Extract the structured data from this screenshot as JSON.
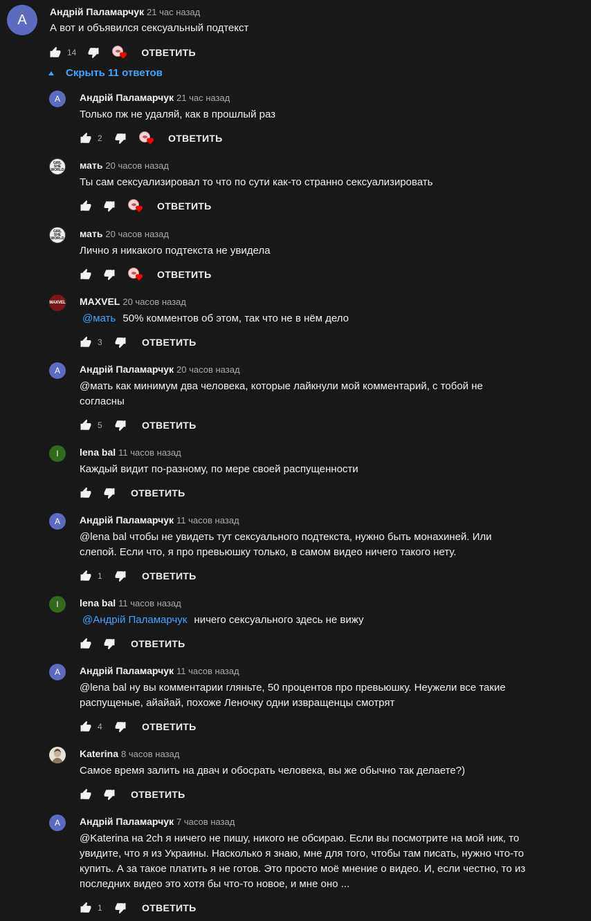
{
  "actions": {
    "reply_label": "ОТВЕТИТЬ"
  },
  "top_comment": {
    "avatar_letter": "A",
    "author": "Андрій Паламарчук",
    "time": "21 час назад",
    "text": "А вот и объявился сексуальный подтекст",
    "likes": "14",
    "hearted": true
  },
  "replies_toggle": {
    "label": "Скрыть 11 ответов"
  },
  "replies": [
    {
      "avatar": "A",
      "author": "Андрій Паламарчук",
      "time": "21 час назад",
      "mention": "",
      "text": "Только пж не удаляй, как в прошлый раз",
      "likes": "2",
      "hearted": true
    },
    {
      "avatar": "mat",
      "author": "мать",
      "time": "20 часов назад",
      "mention": "",
      "text": "Ты сам сексуализировал то что по сути как-то странно сексуализировать",
      "likes": "",
      "hearted": true
    },
    {
      "avatar": "mat",
      "author": "мать",
      "time": "20 часов назад",
      "mention": "",
      "text": "Лично я никакого подтекста не увидела",
      "likes": "",
      "hearted": true
    },
    {
      "avatar": "maxvel",
      "author": "MAXVEL",
      "time": "20 часов назад",
      "mention": "@мать",
      "text": "50% комментов об этом, так что не в нём дело",
      "likes": "3",
      "hearted": false
    },
    {
      "avatar": "A",
      "author": "Андрій Паламарчук",
      "time": "20 часов назад",
      "mention": "",
      "text": "@мать как минимум два человека, которые лайкнули мой комментарий, с тобой не согласны",
      "likes": "5",
      "hearted": false
    },
    {
      "avatar": "l",
      "author": "lena bal",
      "time": "11 часов назад",
      "mention": "",
      "text": "Каждый видит по-разному, по мере своей распущенности",
      "likes": "",
      "hearted": false
    },
    {
      "avatar": "A",
      "author": "Андрій Паламарчук",
      "time": "11 часов назад",
      "mention": "",
      "text": "@lena bal чтобы не увидеть тут сексуального подтекста, нужно быть монахиней. Или слепой. Если что, я про превьюшку только, в самом видео ничего такого нету.",
      "likes": "1",
      "hearted": false
    },
    {
      "avatar": "l",
      "author": "lena bal",
      "time": "11 часов назад",
      "mention": "@Андрій Паламарчук",
      "text": "ничего сексуального здесь не вижу",
      "likes": "",
      "hearted": false
    },
    {
      "avatar": "A",
      "author": "Андрій Паламарчук",
      "time": "11 часов назад",
      "mention": "",
      "text": "@lena bal ну вы комментарии гляньте, 50 процентов про превьюшку. Неужели все такие распущеные, айайай, похоже Леночку одни извращенцы смотрят",
      "likes": "4",
      "hearted": false
    },
    {
      "avatar": "kat",
      "author": "Katerina",
      "time": "8 часов назад",
      "mention": "",
      "text": "Самое время залить на двач и обосрать человека, вы же обычно так делаете?)",
      "likes": "",
      "hearted": false
    },
    {
      "avatar": "A",
      "author": "Андрій Паламарчук",
      "time": "7 часов назад",
      "mention": "",
      "text": "@Katerina на 2ch я ничего не пишу, никого не обсираю. Если вы посмотрите на мой ник, то увидите, что я из Украины. Насколько я знаю, мне для того, чтобы там писать, нужно что-то купить. А за такое платить я не готов. Это просто моё мнение о видео. И, если честно, то из последних видео это хотя бы что-то новое, и мне оно ...",
      "likes": "1",
      "hearted": false
    }
  ],
  "avatar_labels": {
    "mat": "GIRL SHE WORLD",
    "maxvel": "MAXVEL",
    "l": "l",
    "A": "A"
  },
  "colors": {
    "background": "#181818",
    "link": "#3ea6ff",
    "muted": "#aaaaaa",
    "text": "#f1f1f1"
  }
}
